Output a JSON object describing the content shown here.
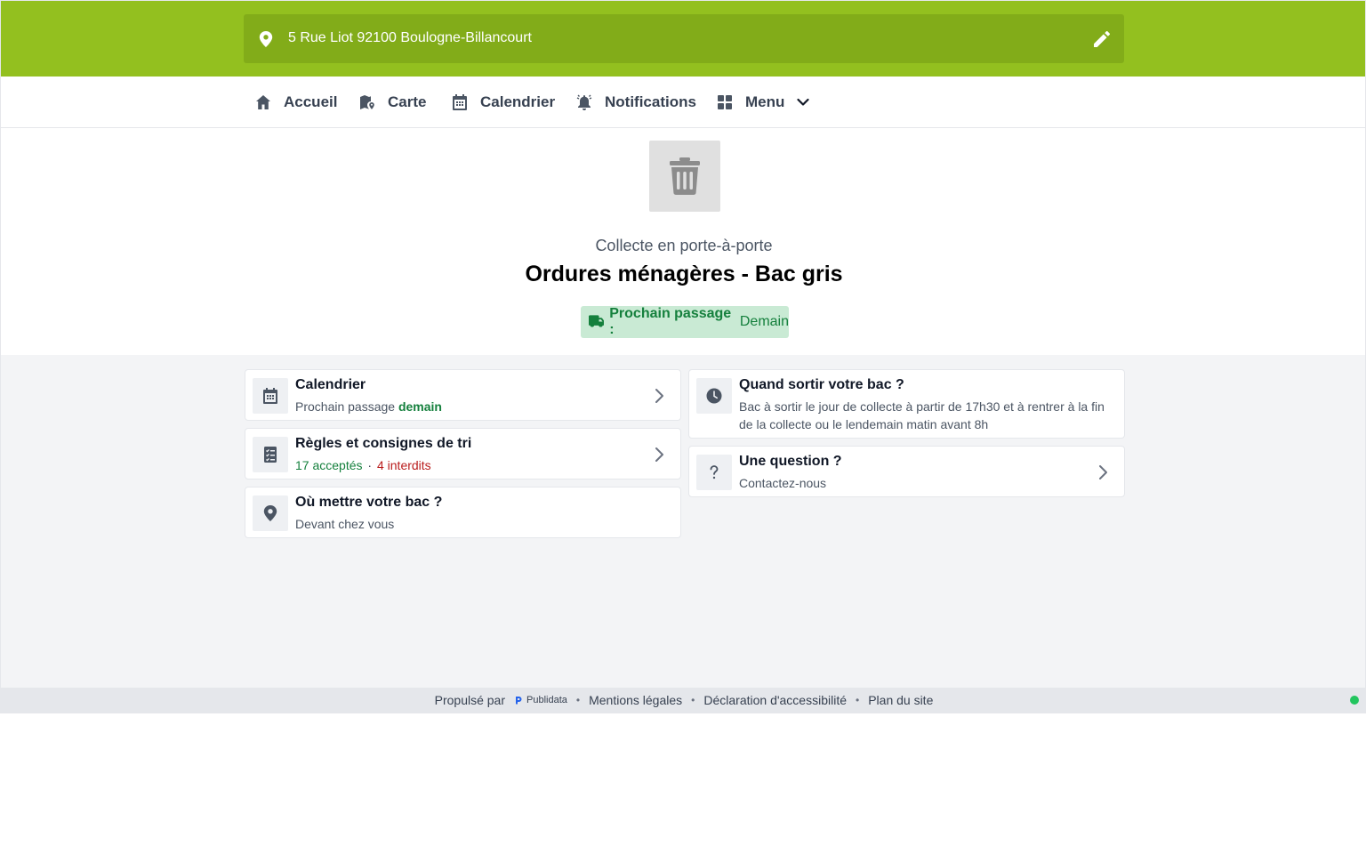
{
  "address": {
    "text": "5 Rue Liot 92100 Boulogne-Billancourt"
  },
  "nav": {
    "items": [
      {
        "label": "Accueil",
        "icon": "home-icon"
      },
      {
        "label": "Carte",
        "icon": "map-icon"
      },
      {
        "label": "Calendrier",
        "icon": "calendar-icon"
      },
      {
        "label": "Notifications",
        "icon": "bell-icon"
      },
      {
        "label": "Menu",
        "icon": "grid-icon"
      }
    ]
  },
  "hero": {
    "subtitle": "Collecte en porte-à-porte",
    "title": "Ordures ménagères - Bac gris",
    "badge_key": "Prochain passage :",
    "badge_value": "Demain"
  },
  "cards": {
    "calendar": {
      "title": "Calendrier",
      "sub_prefix": "Prochain passage",
      "sub_value": "demain"
    },
    "rules": {
      "title": "Règles et consignes de tri",
      "accepted_count": "17",
      "accepted_label": "acceptés",
      "separator": "·",
      "forbidden_count": "4",
      "forbidden_label": "interdits"
    },
    "where": {
      "title": "Où mettre votre bac ?",
      "sub": "Devant chez vous"
    },
    "when": {
      "title": "Quand sortir votre bac ?",
      "sub": "Bac à sortir le jour de collecte à partir de 17h30 et à rentrer à la fin de la collecte ou le lendemain matin avant 8h"
    },
    "question": {
      "title": "Une question ?",
      "sub": "Contactez-nous"
    }
  },
  "footer": {
    "powered": "Propulsé par",
    "brand": "Publidata",
    "legal": "Mentions légales",
    "accessibility": "Déclaration d'accessibilité",
    "sitemap": "Plan du site",
    "separator": "•"
  },
  "colors": {
    "header": "#93c01f",
    "address_bar": "#82ac19",
    "accent_green": "#15803d",
    "badge_bg": "#c9ead4",
    "forbidden_red": "#b91c1c",
    "status_dot": "#22c55e"
  }
}
